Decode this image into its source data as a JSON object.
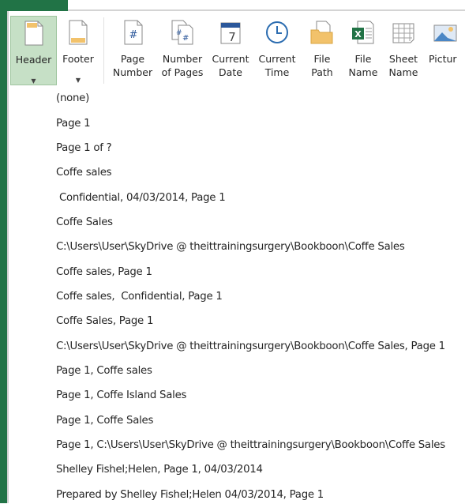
{
  "ribbon": {
    "header": {
      "label": "Header",
      "icon": "header-page-icon"
    },
    "footer": {
      "label": "Footer",
      "icon": "footer-page-icon"
    },
    "page_number": {
      "line1": "Page",
      "line2": "Number",
      "icon": "page-number-icon"
    },
    "number_of_pages": {
      "line1": "Number",
      "line2": "of Pages",
      "icon": "number-of-pages-icon"
    },
    "current_date": {
      "line1": "Current",
      "line2": "Date",
      "icon": "calendar-icon"
    },
    "current_time": {
      "line1": "Current",
      "line2": "Time",
      "icon": "clock-icon"
    },
    "file_path": {
      "line1": "File",
      "line2": "Path",
      "icon": "folder-icon"
    },
    "file_name": {
      "line1": "File",
      "line2": "Name",
      "icon": "excel-file-icon"
    },
    "sheet_name": {
      "line1": "Sheet",
      "line2": "Name",
      "icon": "sheet-grid-icon"
    },
    "picture": {
      "line1": "Pictur",
      "icon": "picture-icon"
    },
    "accent_color": "#217346",
    "active_color": "#c6e0c6"
  },
  "menu": {
    "items": [
      "(none)",
      "Page 1",
      "Page 1 of ?",
      "Coffe sales",
      " Confidential, 04/03/2014, Page 1",
      "Coffe Sales",
      "C:\\Users\\User\\SkyDrive @ theittrainingsurgery\\Bookboon\\Coffe Sales",
      "Coffe sales, Page 1",
      "Coffe sales,  Confidential, Page 1",
      "Coffe Sales, Page 1",
      "C:\\Users\\User\\SkyDrive @ theittrainingsurgery\\Bookboon\\Coffe Sales, Page 1",
      "Page 1, Coffe sales",
      "Page 1, Coffe Island Sales",
      "Page 1, Coffe Sales",
      "Page 1, C:\\Users\\User\\SkyDrive @ theittrainingsurgery\\Bookboon\\Coffe Sales",
      "Shelley Fishel;Helen, Page 1, 04/03/2014",
      "Prepared by Shelley Fishel;Helen 04/03/2014, Page 1"
    ]
  }
}
